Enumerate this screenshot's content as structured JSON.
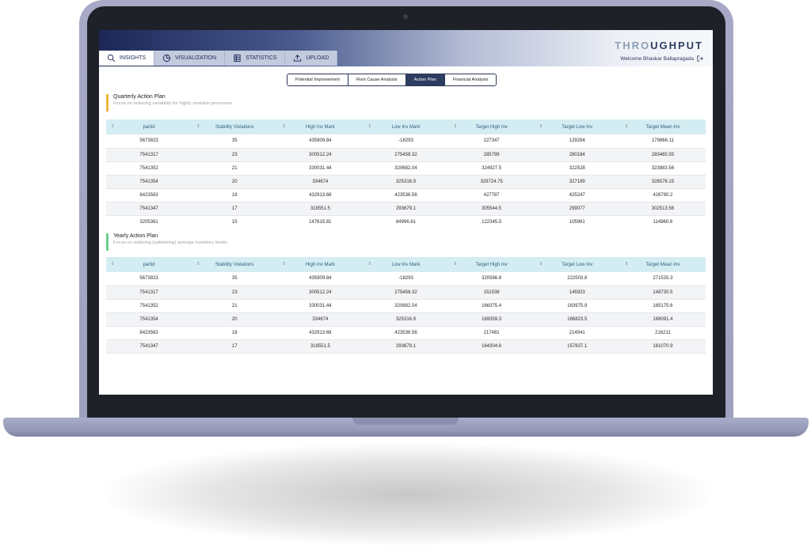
{
  "app": {
    "logo_left": "THR",
    "logo_mid": "O",
    "logo_put": "UGHPUT",
    "welcome": "Welcome Bhaskar Ballapragada"
  },
  "tabs": [
    {
      "label": "INSIGHTS",
      "icon": "insights-icon",
      "active": true
    },
    {
      "label": "VISUALIZATION",
      "icon": "pie-chart-icon",
      "active": false
    },
    {
      "label": "STATISTICS",
      "icon": "spreadsheet-icon",
      "active": false
    },
    {
      "label": "UPLOAD",
      "icon": "upload-icon",
      "active": false
    }
  ],
  "segments": [
    {
      "label": "Potential Improvement",
      "active": false
    },
    {
      "label": "Root Cause Analysis",
      "active": false
    },
    {
      "label": "Action Plan",
      "active": true
    },
    {
      "label": "Financial Analysis",
      "active": false
    }
  ],
  "columns": [
    "partid",
    "Stability Violations",
    "High Inv Mark",
    "Low Inv Mark",
    "Target High Inv",
    "Target Low Inv",
    "Target Mean Inv"
  ],
  "quarterly": {
    "title": "Quarterly Action Plan",
    "description": "Focus on reducing variability for highly unstable processes.",
    "accent": "#f0b43c",
    "rows": [
      [
        "5673823",
        "35",
        "435909.84",
        "-18293",
        "227347",
        "129284",
        "179866.11"
      ],
      [
        "7541317",
        "23",
        "300512.24",
        "275458.32",
        "285799",
        "280184",
        "283465.55"
      ],
      [
        "7541352",
        "21",
        "330031.44",
        "320682.04",
        "324927.5",
        "322528",
        "323883.56"
      ],
      [
        "7541354",
        "20",
        "334674",
        "325316.9",
        "329724.75",
        "327189",
        "328576.15"
      ],
      [
        "8423563",
        "18",
        "432913.68",
        "423536.56",
        "427787",
        "425247",
        "426790.2"
      ],
      [
        "7541347",
        "17",
        "318551.5",
        "293679.1",
        "305544.5",
        "299077",
        "302513.56"
      ],
      [
        "3205361",
        "15",
        "147615.81",
        "84996.61",
        "122345.5",
        "105961",
        "114960.6"
      ]
    ]
  },
  "yearly": {
    "title": "Yearly Action Plan",
    "description": "Focus on reducing (optimizing) average inventory levels.",
    "accent": "#6ccf8e",
    "rows": [
      [
        "5673823",
        "35",
        "435909.84",
        "-18293",
        "320566.8",
        "222503.8",
        "271535.3"
      ],
      [
        "7541317",
        "23",
        "300512.24",
        "275458.32",
        "151538",
        "145923",
        "148730.5"
      ],
      [
        "7541352",
        "21",
        "330031.44",
        "320682.04",
        "166375.4",
        "163975.9",
        "165175.6"
      ],
      [
        "7541354",
        "20",
        "334674",
        "325316.9",
        "169359.3",
        "166823.5",
        "168091.4"
      ],
      [
        "8423563",
        "18",
        "432913.68",
        "423536.56",
        "217481",
        "214941",
        "216211"
      ],
      [
        "7541347",
        "17",
        "318551.5",
        "293679.1",
        "164304.6",
        "157837.1",
        "161070.9"
      ]
    ]
  }
}
